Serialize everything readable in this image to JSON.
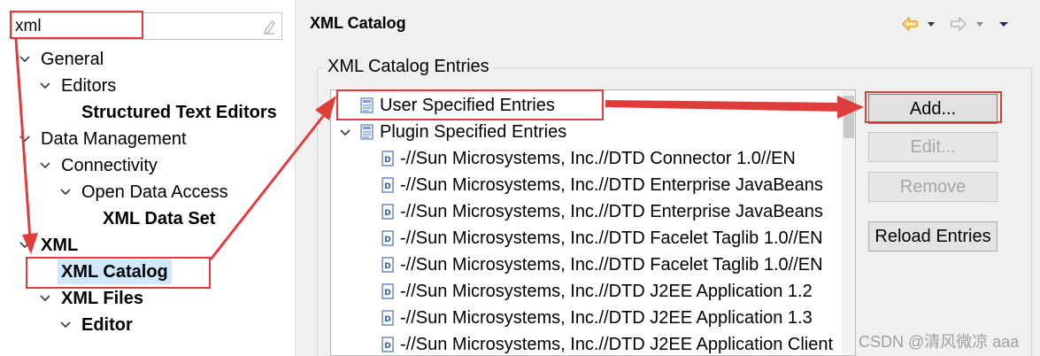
{
  "filter": {
    "value": "xml"
  },
  "left_tree": {
    "general": "General",
    "editors": "Editors",
    "structured_text_editors": "Structured Text Editors",
    "data_management": "Data Management",
    "connectivity": "Connectivity",
    "open_data_access": "Open Data Access",
    "xml_data_set": "XML Data Set",
    "xml": "XML",
    "xml_catalog": "XML Catalog",
    "xml_files": "XML Files",
    "editor": "Editor"
  },
  "page": {
    "title": "XML Catalog",
    "group_label": "XML Catalog Entries"
  },
  "entries": {
    "user_specified": "User Specified Entries",
    "plugin_specified": "Plugin Specified Entries",
    "items": [
      "-//Sun Microsystems, Inc.//DTD Connector 1.0//EN",
      "-//Sun Microsystems, Inc.//DTD Enterprise JavaBeans",
      "-//Sun Microsystems, Inc.//DTD Enterprise JavaBeans",
      "-//Sun Microsystems, Inc.//DTD Facelet Taglib 1.0//EN",
      "-//Sun Microsystems, Inc.//DTD Facelet Taglib 1.0//EN",
      "-//Sun Microsystems, Inc.//DTD J2EE Application 1.2",
      "-//Sun Microsystems, Inc.//DTD J2EE Application 1.3",
      "-//Sun Microsystems, Inc.//DTD J2EE Application Client"
    ]
  },
  "buttons": {
    "add": "Add...",
    "edit": "Edit...",
    "remove": "Remove",
    "reload": "Reload Entries"
  },
  "watermark": "CSDN @清风微凉 aaa",
  "colors": {
    "annotation_red": "#e03c3c",
    "selection": "#cfe8fc",
    "nav_arrow": "#e8a317"
  }
}
